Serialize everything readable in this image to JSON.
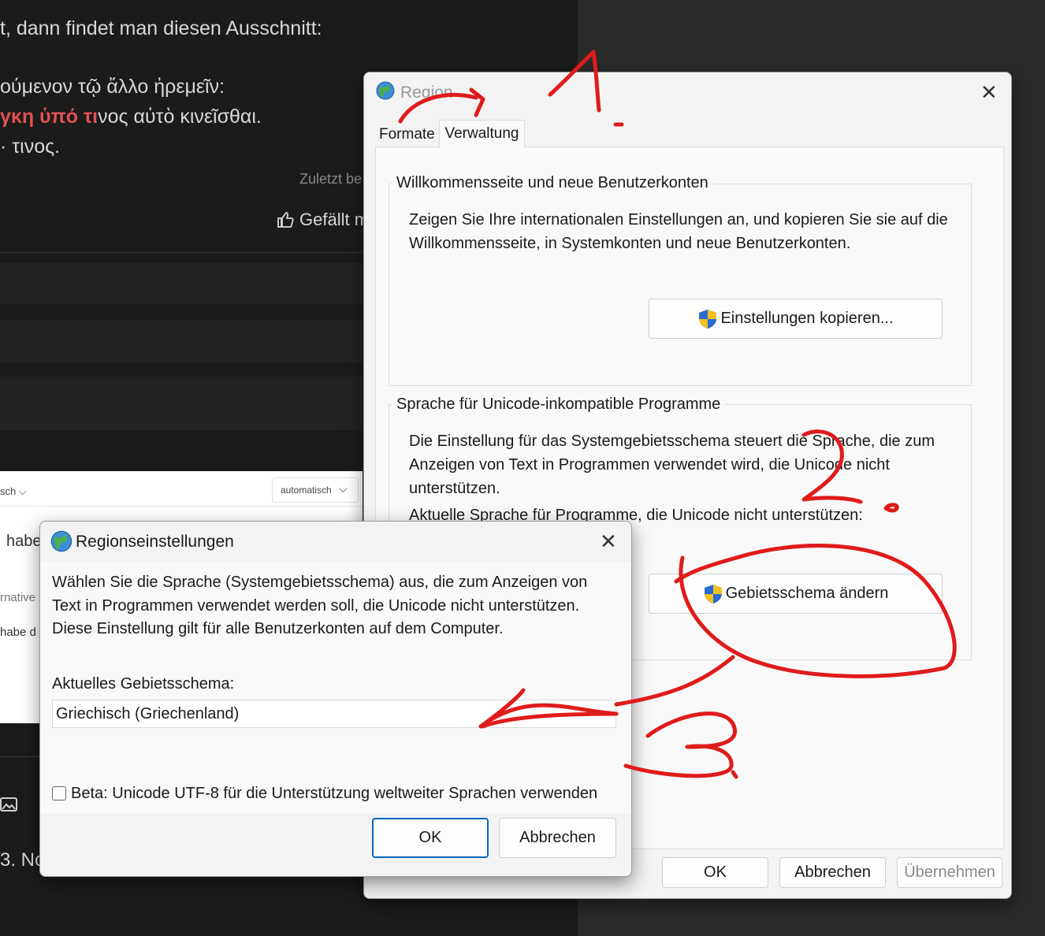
{
  "background": {
    "line1": "t, dann findet man diesen Ausschnitt:",
    "greek1": "ούμενον τῷ ἄλλο ἠρεμεῖν:",
    "greek2_red": "γκη ὑπό τι",
    "greek2_rest": "νος αὐτὸ κινεῖσθαι.",
    "greek3": "· τινος.",
    "last_edited": "Zuletzt be",
    "like_label": "Gefällt m",
    "editor": {
      "lang_select": "sch",
      "auto_select": "automatisch",
      "text_habe": "habe",
      "text_alternative": "rnative",
      "text_habe2": "habe d",
      "bottom_text": "3. No"
    }
  },
  "region_dialog": {
    "title": "Region",
    "tabs": [
      "Formate",
      "Verwaltung"
    ],
    "active_tab": "Verwaltung",
    "group1": {
      "legend": "Willkommensseite und neue Benutzerkonten",
      "description": "Zeigen Sie Ihre internationalen Einstellungen an, und kopieren Sie sie auf die Willkommensseite, in Systemkonten und neue Benutzerkonten.",
      "button": "Einstellungen kopieren..."
    },
    "group2": {
      "legend": "Sprache für Unicode-inkompatible Programme",
      "description": "Die Einstellung für das Systemgebietsschema steuert die Sprache, die zum Anzeigen von Text in Programmen verwendet wird, die Unicode nicht unterstützen.",
      "current_label": "Aktuelle Sprache für Programme, die Unicode nicht unterstützen:",
      "button": "Gebietsschema ändern"
    },
    "ok": "OK",
    "cancel": "Abbrechen",
    "apply": "Übernehmen"
  },
  "locale_dialog": {
    "title": "Regionseinstellungen",
    "description": "Wählen Sie die Sprache (Systemgebietsschema) aus, die zum Anzeigen von Text in Programmen verwendet werden soll, die Unicode nicht unterstützen. Diese Einstellung gilt für alle Benutzerkonten auf dem Computer.",
    "current_label": "Aktuelles Gebietsschema:",
    "current_value": "Griechisch (Griechenland)",
    "beta_checkbox": "Beta: Unicode UTF-8 für die Unterstützung weltweiter Sprachen verwenden",
    "beta_checked": false,
    "ok": "OK",
    "cancel": "Abbrechen"
  },
  "annotations": {
    "color": "#e01b1b",
    "labels": [
      "1.",
      "2.",
      "3."
    ]
  }
}
